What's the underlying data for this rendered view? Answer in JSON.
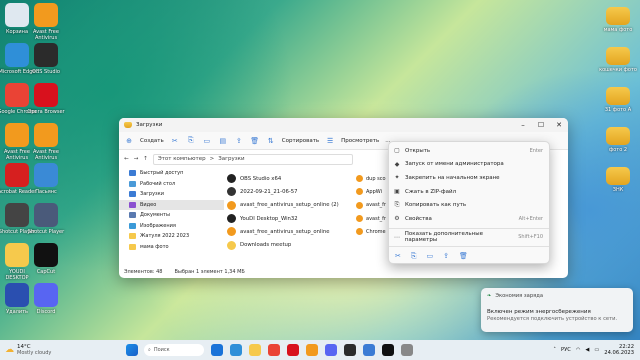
{
  "desktop_left": [
    {
      "label": "Корзина",
      "color": "#dfe8f0"
    },
    {
      "label": "Avast Free Antivirus",
      "color": "#f29a1e"
    },
    {
      "label": "Microsoft Edge",
      "color": "#2f8fd8"
    },
    {
      "label": "OBS Studio",
      "color": "#2b2b2b"
    },
    {
      "label": "Google Chrome",
      "color": "#ea4335"
    },
    {
      "label": "Opera Browser",
      "color": "#d8111d"
    },
    {
      "label": "Avast Free Antivirus",
      "color": "#f29a1e"
    },
    {
      "label": "Avast Free Antivirus",
      "color": "#f29a1e"
    },
    {
      "label": "Acrobat Reader",
      "color": "#d61f1f"
    },
    {
      "label": "Пасьянс",
      "color": "#3a8ad6"
    },
    {
      "label": "Shotcut Player",
      "color": "#444"
    },
    {
      "label": "Shotcut Player",
      "color": "#4a5a7a"
    },
    {
      "label": "YOUDI DESKTOP",
      "color": "#f6c94c"
    },
    {
      "label": "CapCut",
      "color": "#111"
    },
    {
      "label": "Удалить",
      "color": "#2a4fb0"
    },
    {
      "label": "Discord",
      "color": "#5865f2"
    }
  ],
  "desktop_right": [
    {
      "label": "мама фото"
    },
    {
      "label": "кошечки фото"
    },
    {
      "label": "31 фото А"
    },
    {
      "label": "фото 2"
    },
    {
      "label": "ЗНК"
    }
  ],
  "explorer": {
    "title": "Загрузки",
    "toolbar": {
      "create": "Создать",
      "sort": "Сортировать",
      "view": "Просмотреть",
      "more": "..."
    },
    "address": [
      "Этот компьютер",
      ">",
      "Загрузки"
    ],
    "nav": [
      {
        "label": "Быстрый доступ",
        "color": "#3b7bd4"
      },
      {
        "label": "Рабочий стол",
        "color": "#4a9ad8"
      },
      {
        "label": "Загрузки",
        "color": "#3b7bd4"
      },
      {
        "label": "Видео",
        "color": "#8a4fd0"
      },
      {
        "label": "Документы",
        "color": "#5a7ab0"
      },
      {
        "label": "Изображения",
        "color": "#3b9ad8"
      },
      {
        "label": "Жатуля 2022 2023",
        "color": "#f6c94c"
      },
      {
        "label": "мама фото",
        "color": "#f6c94c"
      }
    ],
    "files": [
      {
        "label": "OBS Studio x64",
        "color": "#222"
      },
      {
        "label": "2022-09-21_21-06-57",
        "color": "#333"
      },
      {
        "label": "avast_free_antivirus_setup_online (2)",
        "color": "#f29a1e"
      },
      {
        "label": "YouDI Desktop_Win32",
        "color": "#222"
      },
      {
        "label": "avast_free_antivirus_setup_online",
        "color": "#f29a1e"
      },
      {
        "label": "Downloads meetup",
        "color": "#f6c94c"
      }
    ],
    "files2": [
      "dup sco",
      "AppWi",
      "avast_fr",
      "avast_fr",
      "Chrome"
    ],
    "status": [
      "Элементов: 48",
      "Выбран 1 элемент 1,34 МБ"
    ]
  },
  "context_menu": {
    "items": [
      {
        "label": "Открыть",
        "shortcut": "Enter",
        "icon": "▢"
      },
      {
        "label": "Запуск от имени администратора",
        "shortcut": "",
        "icon": "◆"
      },
      {
        "label": "Закрепить на начальном экране",
        "shortcut": "",
        "icon": "✦"
      },
      {
        "label": "Сжать в ZIP-файл",
        "shortcut": "",
        "icon": "▣"
      },
      {
        "label": "Копировать как путь",
        "shortcut": "",
        "icon": "⎘"
      },
      {
        "label": "Свойства",
        "shortcut": "Alt+Enter",
        "icon": "⚙"
      }
    ],
    "more": {
      "label": "Показать дополнительные параметры",
      "shortcut": "Shift+F10",
      "icon": "⋯"
    },
    "actions": [
      "✂",
      "⎘",
      "▭",
      "⇪",
      "🗑"
    ]
  },
  "toast": {
    "title": "Экономия заряда",
    "heading": "Включен режим энергосбережения",
    "body": "Рекомендуется подключить устройство к сети."
  },
  "taskbar": {
    "weather_temp": "14°C",
    "weather_text": "Mostly cloudy",
    "search_placeholder": "Поиск",
    "time": "22:22",
    "date": "24.06.2023",
    "icons": [
      "#1a73d8",
      "#2f8fd8",
      "#f6c94c",
      "#ea4335",
      "#d8111d",
      "#f29a1e",
      "#5865f2",
      "#2b2b2b",
      "#3b7bd4",
      "#111",
      "#888"
    ]
  }
}
